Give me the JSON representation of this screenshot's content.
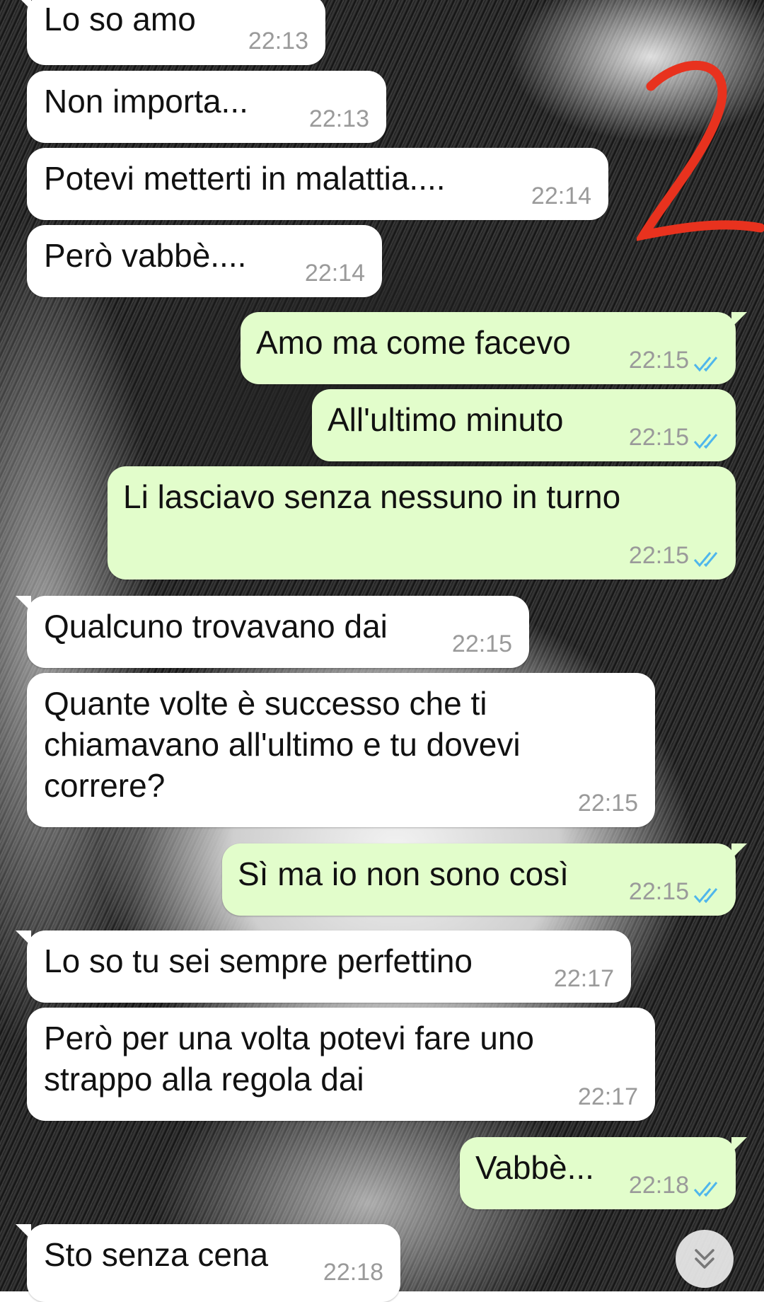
{
  "messages": [
    {
      "dir": "in",
      "text": "Lo so amo",
      "time": "22:13"
    },
    {
      "dir": "in",
      "text": "Non importa...",
      "time": "22:13"
    },
    {
      "dir": "in",
      "text": "Potevi metterti in malattia....",
      "time": "22:14"
    },
    {
      "dir": "in",
      "text": "Però vabbè....",
      "time": "22:14"
    },
    {
      "dir": "out",
      "text": "Amo ma come facevo",
      "time": "22:15"
    },
    {
      "dir": "out",
      "text": "All'ultimo minuto",
      "time": "22:15"
    },
    {
      "dir": "out",
      "text": "Li lasciavo senza nessuno in turno",
      "time": "22:15"
    },
    {
      "dir": "in",
      "text": "Qualcuno trovavano dai",
      "time": "22:15"
    },
    {
      "dir": "in",
      "text": "Quante volte è successo che ti\nchiamavano all'ultimo e tu dovevi\ncorrere?",
      "time": "22:15"
    },
    {
      "dir": "out",
      "text": "Sì ma io non sono così",
      "time": "22:15"
    },
    {
      "dir": "in",
      "text": "Lo so tu sei sempre perfettino",
      "time": "22:17"
    },
    {
      "dir": "in",
      "text": "Però per una volta potevi fare uno\nstrappo alla regola dai",
      "time": "22:17"
    },
    {
      "dir": "out",
      "text": "Vabbè...",
      "time": "22:18"
    },
    {
      "dir": "in",
      "text": "Sto senza cena",
      "time": "22:18"
    }
  ],
  "colors": {
    "incoming": "#ffffff",
    "outgoing": "#e2fdcb",
    "read_ticks": "#4fb6ec",
    "annotation": "#e8321e"
  },
  "icons": {
    "read_status": "double-check-icon",
    "scroll": "chevron-down-double-icon"
  }
}
